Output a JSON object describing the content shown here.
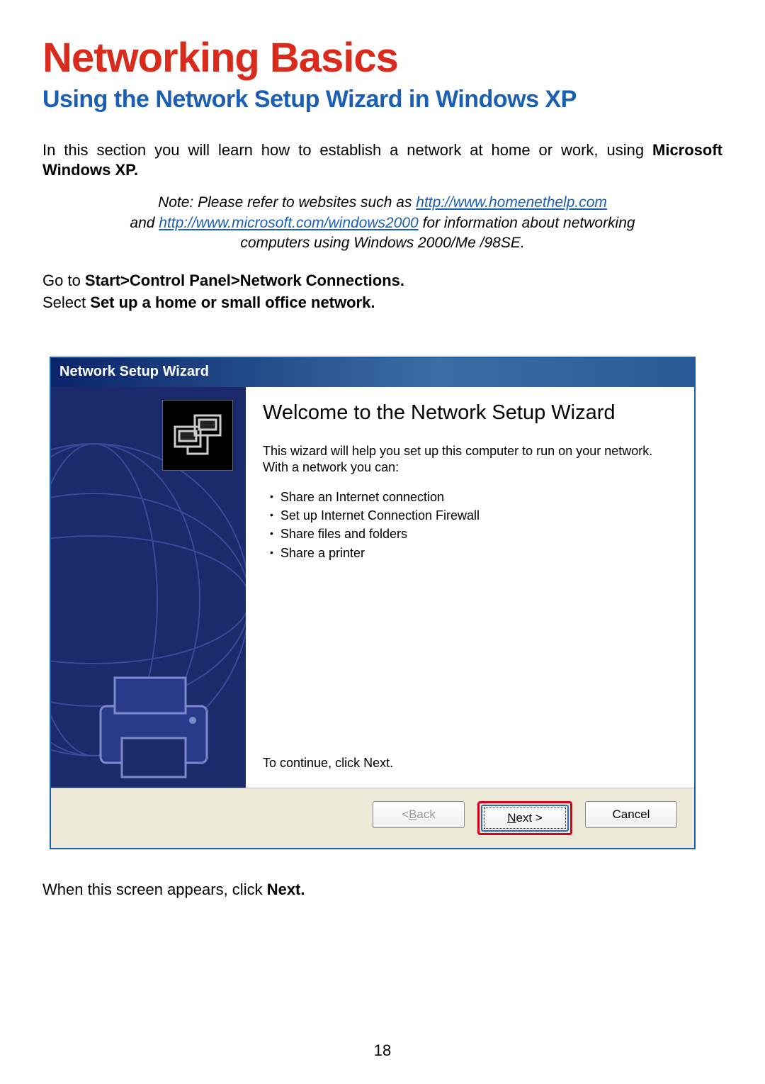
{
  "title": "Networking Basics",
  "subtitle": "Using the Network Setup Wizard in Windows XP",
  "intro_prefix": "In this section you will learn how to establish a network at home or work, using ",
  "intro_bold": "Microsoft Windows XP.",
  "note": {
    "line1_pre": "Note:  Please refer to websites such as ",
    "link1": "http://www.homenethelp.com",
    "line2_pre": "and ",
    "link2": "http://www.microsoft.com/windows2000",
    "line2_post": "  for information about networking",
    "line3": "computers using Windows 2000/Me /98SE."
  },
  "instructions": {
    "line1_pre": "Go to ",
    "line1_bold": "Start>Control Panel>Network Connections.",
    "line2_pre": "Select ",
    "line2_bold": "Set up a home or small office network."
  },
  "wizard": {
    "titlebar": "Network Setup Wizard",
    "heading": "Welcome to the Network Setup Wizard",
    "body_text": "This wizard will help you set up this computer to run on your network. With a network you can:",
    "bullets": [
      "Share an Internet connection",
      "Set up Internet Connection Firewall",
      "Share files and folders",
      "Share a printer"
    ],
    "continue_text": "To continue, click Next.",
    "buttons": {
      "back_pre": "< ",
      "back_u": "B",
      "back_post": "ack",
      "next_u": "N",
      "next_post": "ext >",
      "cancel": "Cancel"
    }
  },
  "closing_pre": "When this screen appears, click ",
  "closing_bold": "Next.",
  "page_number": "18"
}
